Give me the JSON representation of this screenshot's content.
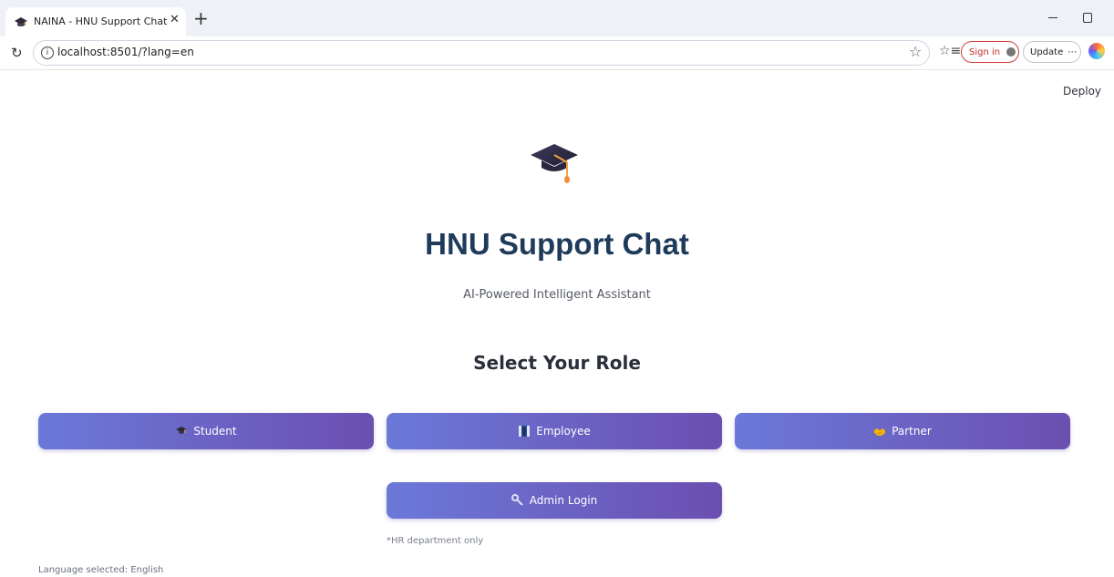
{
  "browser": {
    "tab_title": "NAINA - HNU Support Chat",
    "url": "localhost:8501/?lang=en",
    "signin_label": "Sign in",
    "update_label": "Update",
    "update_more": "⋯"
  },
  "app": {
    "deploy_label": "Deploy",
    "title": "HNU Support Chat",
    "subtitle": "AI-Powered Intelligent Assistant",
    "section_title": "Select Your Role",
    "roles": [
      {
        "label": "Student",
        "icon": "graduation-cap-icon"
      },
      {
        "label": "Employee",
        "icon": "necktie-icon"
      },
      {
        "label": "Partner",
        "icon": "handshake-icon"
      }
    ],
    "admin_label": "Admin Login",
    "admin_note": "*HR department only",
    "language_status": "Language selected: English"
  },
  "colors": {
    "button_gradient_start": "#6b79d9",
    "button_gradient_end": "#6b4fb0",
    "title_color": "#1f3b5b"
  }
}
